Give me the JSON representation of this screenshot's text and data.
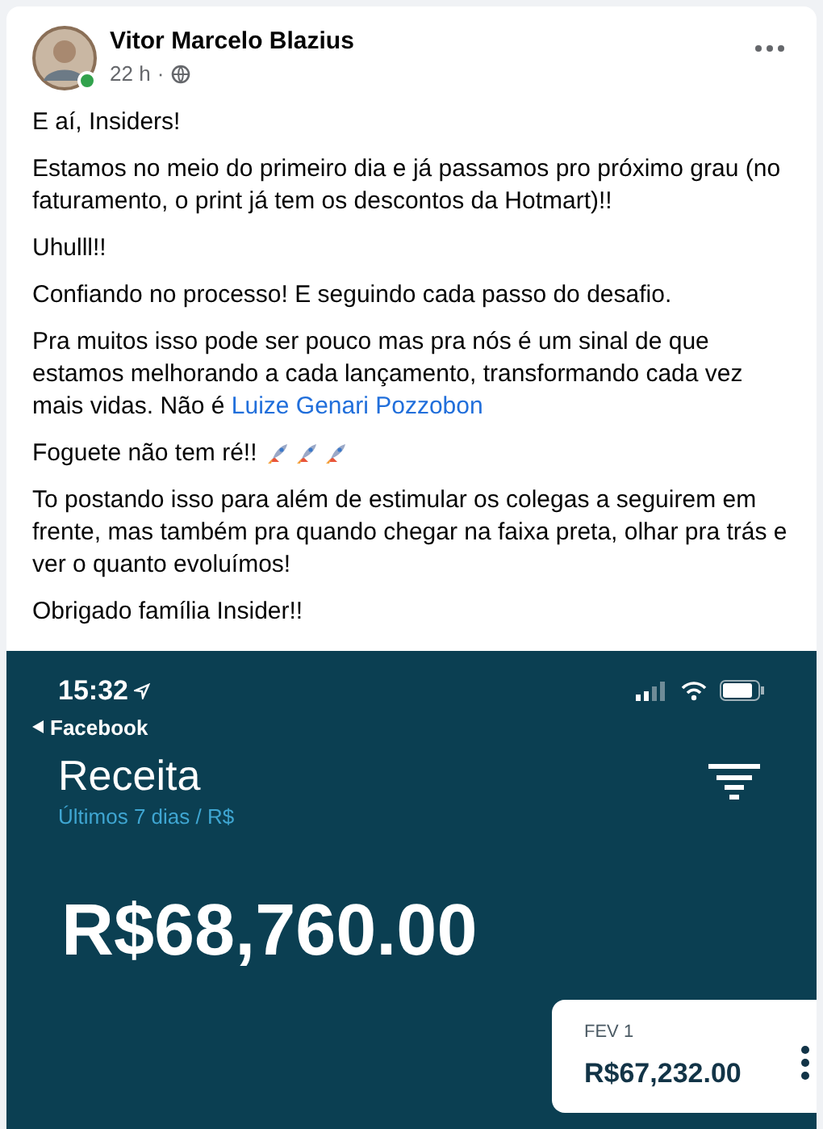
{
  "post": {
    "author": "Vitor Marcelo Blazius",
    "online": true,
    "time": "22 h",
    "separator": "·",
    "paragraphs": [
      {
        "text": "E aí, Insiders!"
      },
      {
        "text": "Estamos no meio do primeiro dia e já passamos pro próximo grau (no faturamento, o print já tem os descontos da Hotmart)!!"
      },
      {
        "text": "Uhulll!!"
      },
      {
        "text": "Confiando no processo! E seguindo cada passo do desafio."
      },
      {
        "text": "Pra muitos isso pode ser pouco mas pra nós é um sinal de que estamos melhorando a cada lançamento, transformando cada vez mais vidas. Não é",
        "link": "Luize Genari Pozzobon"
      },
      {
        "text": "Foguete não tem ré!!",
        "kind": "rockets"
      },
      {
        "text": "To postando isso para além de estimular os colegas a seguirem em frente, mas também pra quando chegar na faixa preta, olhar pra trás e ver o quanto evoluímos!"
      },
      {
        "text": "Obrigado família Insider!!"
      }
    ]
  },
  "phone": {
    "time": "15:32",
    "back": "Facebook",
    "title": "Receita",
    "subtitle": "Últimos 7 dias / R$",
    "total": "R$68,760.00",
    "tooltip": {
      "label": "FEV 1",
      "value": "R$67,232.00"
    }
  }
}
